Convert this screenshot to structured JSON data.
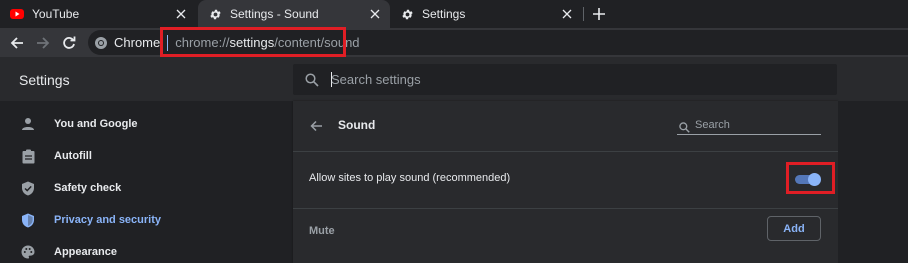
{
  "tabs": [
    {
      "title": "YouTube",
      "icon": "youtube-icon"
    },
    {
      "title": "Settings - Sound",
      "icon": "gear-icon"
    },
    {
      "title": "Settings",
      "icon": "gear-icon"
    }
  ],
  "toolbar": {
    "chip_label": "Chrome",
    "url_scheme": "chrome://",
    "url_host": "settings",
    "url_path": "/content/sound"
  },
  "header": {
    "title": "Settings",
    "search_placeholder": "Search settings"
  },
  "sidebar": {
    "items": [
      {
        "label": "You and Google",
        "icon": "person-icon"
      },
      {
        "label": "Autofill",
        "icon": "clipboard-icon"
      },
      {
        "label": "Safety check",
        "icon": "shield-check-icon"
      },
      {
        "label": "Privacy and security",
        "icon": "shield-icon"
      },
      {
        "label": "Appearance",
        "icon": "palette-icon"
      }
    ]
  },
  "main": {
    "title": "Sound",
    "search_placeholder": "Search",
    "allow_sound_label": "Allow sites to play sound (recommended)",
    "allow_sound_enabled": true,
    "mute_label": "Mute",
    "add_button_label": "Add"
  },
  "colors": {
    "accent": "#8ab4f8",
    "highlight": "#e01e25",
    "youtube_red": "#ff0000"
  }
}
